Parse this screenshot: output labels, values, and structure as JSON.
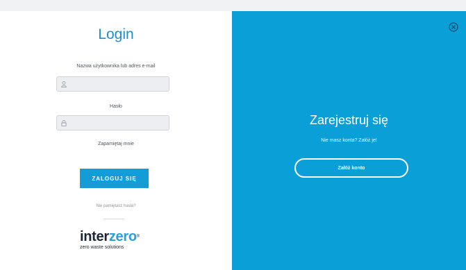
{
  "login": {
    "title": "Login",
    "username_label": "Nazwa użytkownika lub adres e-mail",
    "username_value": "",
    "password_label": "Hasło",
    "password_value": "",
    "remember_label": "Zapamiętaj mnie",
    "submit_label": "ZALOGUJ SIĘ",
    "forgot_label": "Nie pamiętasz hasła?"
  },
  "brand": {
    "word_a": "inter",
    "word_b": "zero",
    "mark": "®",
    "tagline": "zero waste solutions",
    "accent_color": "#2a9fd8"
  },
  "register": {
    "title": "Zarejestruj się",
    "subtitle": "Nie masz konta? Załóż je!",
    "button_label": "Załóż konto",
    "panel_color": "#0b9fd8"
  },
  "icons": {
    "close": "close-circle-icon",
    "user": "user-icon",
    "lock": "lock-icon"
  }
}
